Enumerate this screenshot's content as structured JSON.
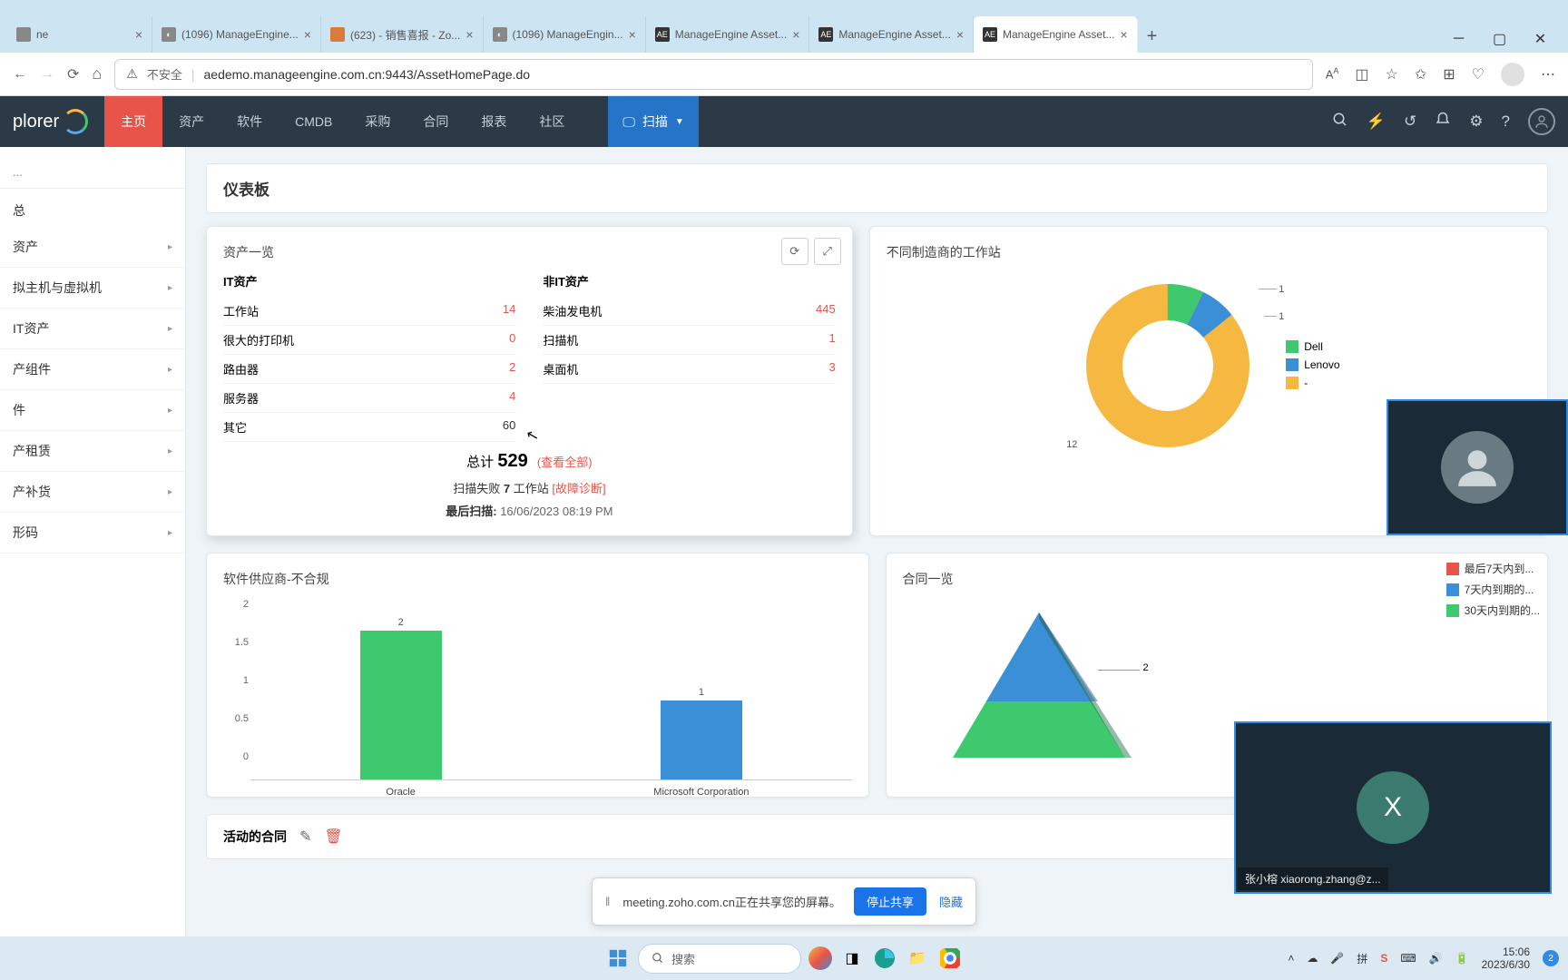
{
  "browser": {
    "tabs": [
      {
        "title": "ne",
        "fav_bg": "#888",
        "fav_txt": ""
      },
      {
        "title": "(1096) ManageEngine...",
        "fav_bg": "#888",
        "fav_txt": "◐"
      },
      {
        "title": "(623) - 销售喜报 - Zo...",
        "fav_bg": "#d97b3c",
        "fav_txt": ""
      },
      {
        "title": "(1096) ManageEngin...",
        "fav_bg": "#888",
        "fav_txt": "◐"
      },
      {
        "title": "ManageEngine Asset...",
        "fav_bg": "#333",
        "fav_txt": "AE"
      },
      {
        "title": "ManageEngine Asset...",
        "fav_bg": "#333",
        "fav_txt": "AE"
      },
      {
        "title": "ManageEngine Asset...",
        "fav_bg": "#333",
        "fav_txt": "AE",
        "active": true
      }
    ],
    "insecure": "不安全",
    "url": "aedemo.manageengine.com.cn:9443/AssetHomePage.do"
  },
  "header": {
    "logo": "plorer",
    "nav": [
      "主页",
      "资产",
      "软件",
      "CMDB",
      "采购",
      "合同",
      "报表",
      "社区"
    ],
    "active_nav": "主页",
    "scan": "扫描"
  },
  "sidebar": {
    "search_placeholder": "...",
    "heading": "总",
    "items": [
      "资产",
      "拟主机与虚拟机",
      "IT资产",
      "产组件",
      "件",
      "产租赁",
      "产补货",
      "形码"
    ]
  },
  "page": {
    "title": "仪表板"
  },
  "asset_summary": {
    "title": "资产一览",
    "it_title": "IT资产",
    "nonit_title": "非IT资产",
    "it_rows": [
      {
        "label": "工作站",
        "val": "14"
      },
      {
        "label": "很大的打印机",
        "val": "0"
      },
      {
        "label": "路由器",
        "val": "2"
      },
      {
        "label": "服务器",
        "val": "4"
      },
      {
        "label": "其它",
        "val": "60",
        "dark": true
      }
    ],
    "nonit_rows": [
      {
        "label": "柴油发电机",
        "val": "445"
      },
      {
        "label": "扫描机",
        "val": "1"
      },
      {
        "label": "桌面机",
        "val": "3"
      }
    ],
    "total_label": "总计",
    "total_val": "529",
    "view_all": "(查看全部)",
    "fail_prefix": "扫描失败",
    "fail_count": "7",
    "fail_item": "工作站",
    "fail_diag": "[故障诊断]",
    "last_scan_label": "最后扫描:",
    "last_scan_time": "16/06/2023 08:19 PM"
  },
  "mfg_card": {
    "title": "不同制造商的工作站",
    "legend": [
      {
        "name": "Dell",
        "color": "#3ec96e"
      },
      {
        "name": "Lenovo",
        "color": "#3b8fd6"
      },
      {
        "name": "-",
        "color": "#f5b942"
      }
    ],
    "val_big": "12",
    "val_small1": "1",
    "val_small2": "1"
  },
  "chart_data": [
    {
      "type": "pie",
      "title": "不同制造商的工作站",
      "series": [
        {
          "name": "workstations",
          "values": [
            1,
            1,
            12
          ]
        }
      ],
      "categories": [
        "Dell",
        "Lenovo",
        "-"
      ],
      "donut": true
    },
    {
      "type": "bar",
      "title": "软件供应商-不合规",
      "categories": [
        "Oracle",
        "Microsoft Corporation"
      ],
      "values": [
        2,
        1
      ],
      "ylim": [
        0,
        2
      ],
      "yticks": [
        0,
        0.5,
        1,
        1.5,
        2
      ]
    },
    {
      "type": "pyramid",
      "title": "合同一览",
      "categories": [
        "最后7天内到...",
        "7天内到期的...",
        "30天内到期的..."
      ],
      "values": [
        null,
        2,
        null
      ],
      "colors": [
        "#e8534a",
        "#3b8fd6",
        "#3ec96e"
      ]
    }
  ],
  "software_card": {
    "title": "软件供应商-不合规"
  },
  "contract_card": {
    "title": "合同一览",
    "legend": [
      {
        "name": "最后7天内到...",
        "color": "#e8534a"
      },
      {
        "name": "7天内到期的...",
        "color": "#3b8fd6"
      },
      {
        "name": "30天内到期的...",
        "color": "#3ec96e"
      }
    ],
    "label_2": "2"
  },
  "active_contracts": {
    "title": "活动的合同"
  },
  "sharing": {
    "text": "meeting.zoho.com.cn正在共享您的屏幕。",
    "stop": "停止共享",
    "hide": "隐藏"
  },
  "video": {
    "avatar_letter": "X",
    "name": "张小榕 xiaorong.zhang@z..."
  },
  "taskbar": {
    "search": "搜索",
    "time": "15:06",
    "date": "2023/6/30"
  }
}
